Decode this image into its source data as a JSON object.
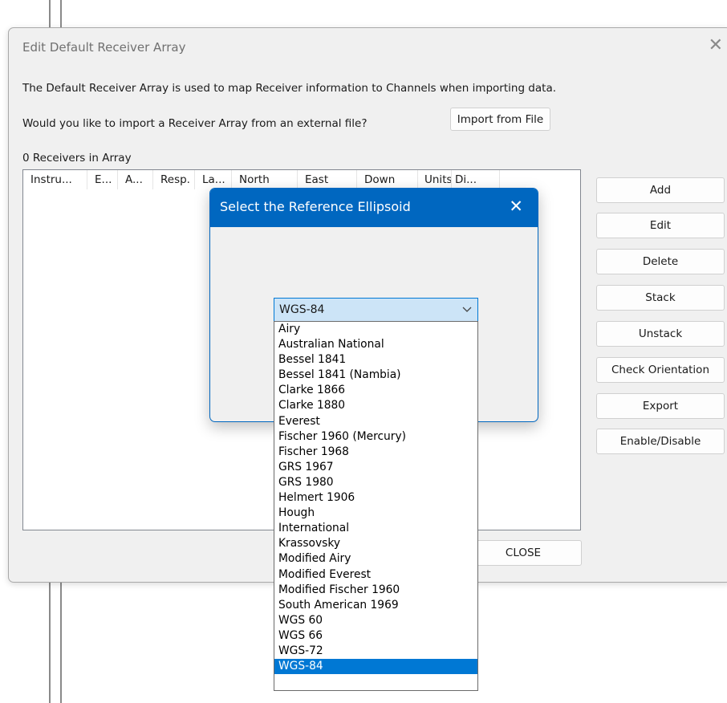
{
  "dialog": {
    "title": "Edit Default Receiver Array",
    "intro_text": "The Default Receiver Array is used to map Receiver information to Channels when importing data.",
    "import_question": "Would you like to import a Receiver Array from an external file?",
    "import_button": "Import from File",
    "receiver_count": "0 Receivers in Array",
    "columns": [
      "Instru...",
      "E...",
      "A...",
      "Resp.",
      "La...",
      "North",
      "East",
      "Down",
      "Units",
      "Di..."
    ],
    "side_buttons": [
      "Add",
      "Edit",
      "Delete",
      "Stack",
      "Unstack",
      "Check Orientation",
      "Export",
      "Enable/Disable"
    ],
    "close_button": "CLOSE"
  },
  "modal": {
    "title": "Select the Reference Ellipsoid",
    "selected_value": "WGS-84",
    "options": [
      "Airy",
      "Australian National",
      "Bessel 1841",
      "Bessel 1841 (Nambia)",
      "Clarke 1866",
      "Clarke 1880",
      "Everest",
      "Fischer 1960 (Mercury)",
      "Fischer 1968",
      "GRS 1967",
      "GRS 1980",
      "Helmert 1906",
      "Hough",
      "International",
      "Krassovsky",
      "Modified Airy",
      "Modified Everest",
      "Modified Fischer 1960",
      "South American 1969",
      "WGS 60",
      "WGS 66",
      "WGS-72",
      "WGS-84"
    ]
  },
  "colors": {
    "accent": "#0067c0",
    "selection": "#0078d4",
    "combo_bg": "#cce4f7",
    "dialog_bg": "#f0f0f0"
  },
  "icons": {
    "dialog_close": "close-icon",
    "modal_close": "close-icon",
    "combo_arrow": "chevron-down-icon"
  }
}
